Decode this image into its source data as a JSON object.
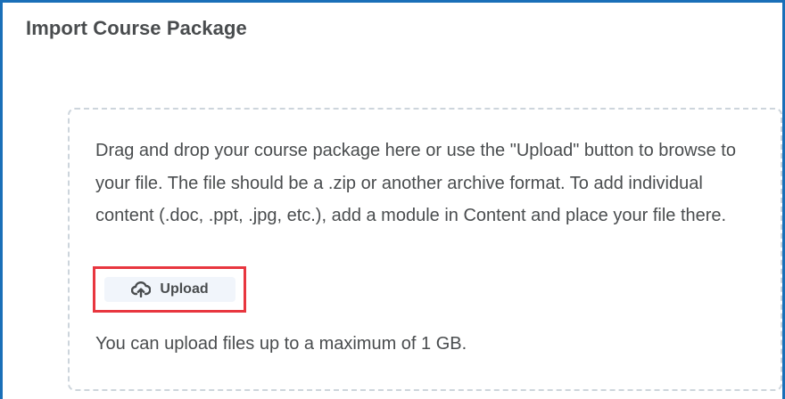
{
  "page": {
    "title": "Import Course Package"
  },
  "dropzone": {
    "instructions": "Drag and drop your course package here or use the \"Upload\" button to browse to your file. The file should be a .zip or another archive format. To add individual content (.doc, .ppt, .jpg, etc.), add a module in Content and place your file there.",
    "upload_button_label": "Upload",
    "upload_icon": "cloud-upload-icon",
    "limit_note": "You can upload files up to a maximum of 1 GB."
  },
  "colors": {
    "frame_border": "#1a6fb8",
    "highlight_border": "#e8363f",
    "text": "#494c4e",
    "dropzone_border": "#cdd5dc",
    "button_background": "#f1f5fb"
  }
}
